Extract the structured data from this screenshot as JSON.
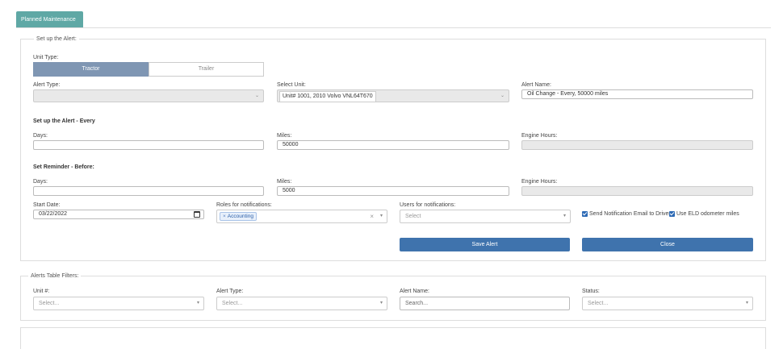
{
  "tabs": {
    "planned_maintenance": "Planned Maintenance"
  },
  "alert_setup": {
    "legend": "Set up the Alert:",
    "unit_type_label": "Unit Type:",
    "unit_type_options": [
      "Tractor",
      "Trailer"
    ],
    "unit_type_selected": "Tractor",
    "alert_type_label": "Alert Type:",
    "alert_type_value": "",
    "select_unit_label": "Select Unit:",
    "select_unit_value": "Unit# 1001, 2010 Volvo VNL64T670",
    "alert_name_label": "Alert Name:",
    "alert_name_value": "Oil Change - Every, 50000 miles",
    "every_heading": "Set up the Alert - Every",
    "every_days_label": "Days:",
    "every_days_value": "",
    "every_miles_label": "Miles:",
    "every_miles_value": "50000",
    "every_engine_hours_label": "Engine Hours:",
    "every_engine_hours_value": "",
    "reminder_heading": "Set Reminder - Before:",
    "reminder_days_label": "Days:",
    "reminder_days_value": "",
    "reminder_miles_label": "Miles:",
    "reminder_miles_value": "5000",
    "reminder_engine_hours_label": "Engine Hours:",
    "reminder_engine_hours_value": "",
    "start_date_label": "Start Date:",
    "start_date_value": "03/22/2022",
    "roles_label": "Roles for notifications:",
    "roles_tags": [
      "Accounting"
    ],
    "users_label": "Users for notifications:",
    "users_placeholder": "Select",
    "send_email_label": "Send Notification Email to Driver",
    "send_email_checked": true,
    "use_eld_label": "Use ELD odometer miles",
    "use_eld_checked": true,
    "save_button": "Save Alert",
    "close_button": "Close"
  },
  "filters": {
    "legend": "Alerts Table Filters:",
    "unit_label": "Unit #:",
    "unit_placeholder": "Select...",
    "alert_type_label": "Alert Type:",
    "alert_type_placeholder": "Select...",
    "alert_name_label": "Alert Name:",
    "alert_name_placeholder": "Search...",
    "status_label": "Status:",
    "status_placeholder": "Select..."
  },
  "colors": {
    "tab": "#5fa8a5",
    "toggle_active": "#7f96b3",
    "primary_button": "#3f73ad",
    "checkbox": "#2d6ab5"
  }
}
